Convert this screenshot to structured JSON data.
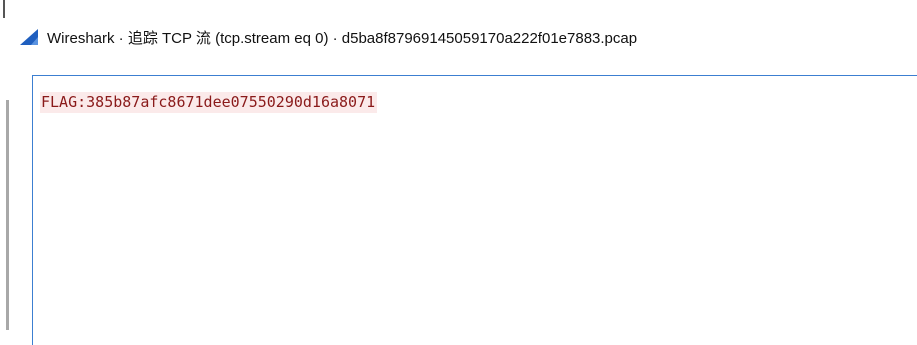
{
  "window": {
    "title": "Wireshark · 追踪 TCP 流 (tcp.stream eq 0) · d5ba8f87969145059170a222f01e7883.pcap",
    "app_icon": "wireshark-fin-icon",
    "icon_color": "#1f5fbf"
  },
  "stream": {
    "lines": [
      "FLAG:385b87afc8671dee07550290d16a8071"
    ],
    "client_text_color": "#8a1a1a",
    "client_bg_color": "#fbeaea"
  },
  "colors": {
    "content_border": "#3c7fd1"
  }
}
